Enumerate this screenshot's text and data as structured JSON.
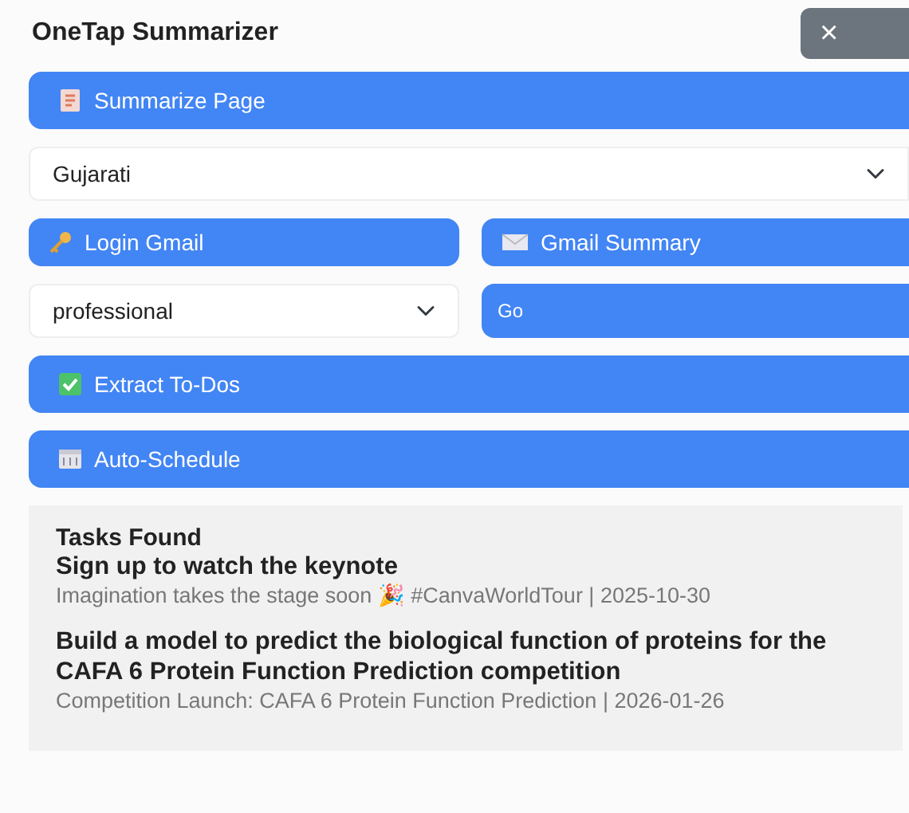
{
  "title": "OneTap Summarizer",
  "close_button": {
    "label": "×"
  },
  "summarize_button": {
    "label": "Summarize Page"
  },
  "language_select": {
    "value": "Gujarati"
  },
  "gmail_buttons": [
    {
      "label": "Login Gmail"
    },
    {
      "label": "Gmail Summary"
    }
  ],
  "tone_select": {
    "value": "professional"
  },
  "go_button": {
    "label": "Go"
  },
  "action_buttons": [
    {
      "label": "Extract To-Dos"
    },
    {
      "label": "Auto-Schedule"
    }
  ],
  "results": {
    "heading": "Tasks Found",
    "tasks": [
      {
        "title": "Sign up to watch the keynote",
        "detail": "Imagination takes the stage soon 🎉 #CanvaWorldTour | 2025-10-30"
      },
      {
        "title": "Build a model to predict the biological function of proteins for the CAFA 6 Protein Function Prediction competition",
        "detail": "Competition Launch: CAFA 6 Protein Function Prediction | 2026-01-26"
      }
    ]
  }
}
